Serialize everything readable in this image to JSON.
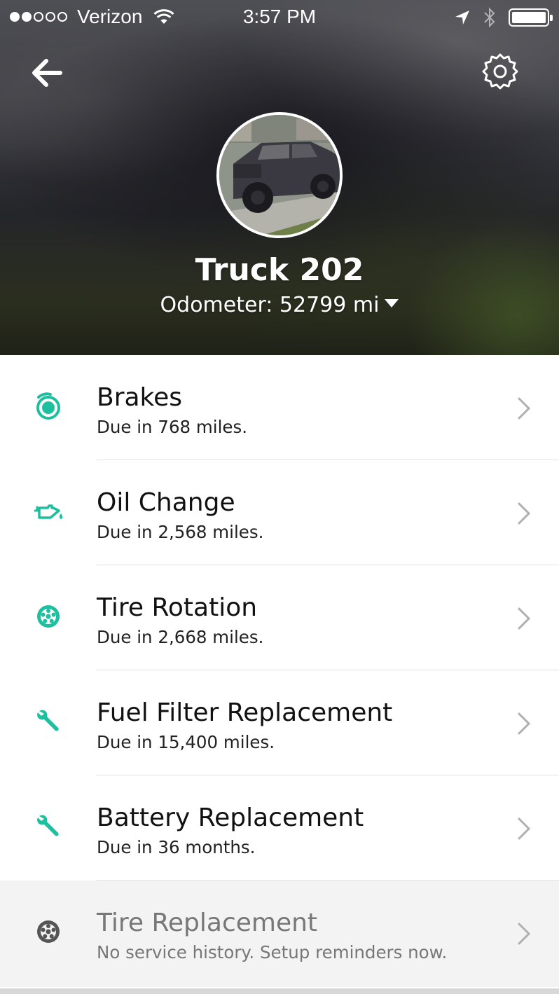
{
  "status_bar": {
    "carrier": "Verizon",
    "time": "3:57 PM",
    "signal_strength": 2
  },
  "header": {
    "vehicle_name": "Truck 202",
    "odometer_label": "Odometer: 52799 mi"
  },
  "accent_color": "#1dbf9f",
  "inactive_color": "#555555",
  "services": [
    {
      "icon": "brake-disc-icon",
      "title": "Brakes",
      "subtitle": "Due in 768 miles."
    },
    {
      "icon": "oil-can-icon",
      "title": "Oil Change",
      "subtitle": "Due in 2,568 miles."
    },
    {
      "icon": "tire-icon",
      "title": "Tire Rotation",
      "subtitle": "Due in 2,668 miles."
    },
    {
      "icon": "wrench-icon",
      "title": "Fuel Filter Replacement",
      "subtitle": "Due in 15,400 miles."
    },
    {
      "icon": "wrench-icon",
      "title": "Battery Replacement",
      "subtitle": "Due in 36 months."
    },
    {
      "icon": "tire-icon",
      "title": "Tire Replacement",
      "subtitle": "No service history. Setup reminders now."
    }
  ]
}
